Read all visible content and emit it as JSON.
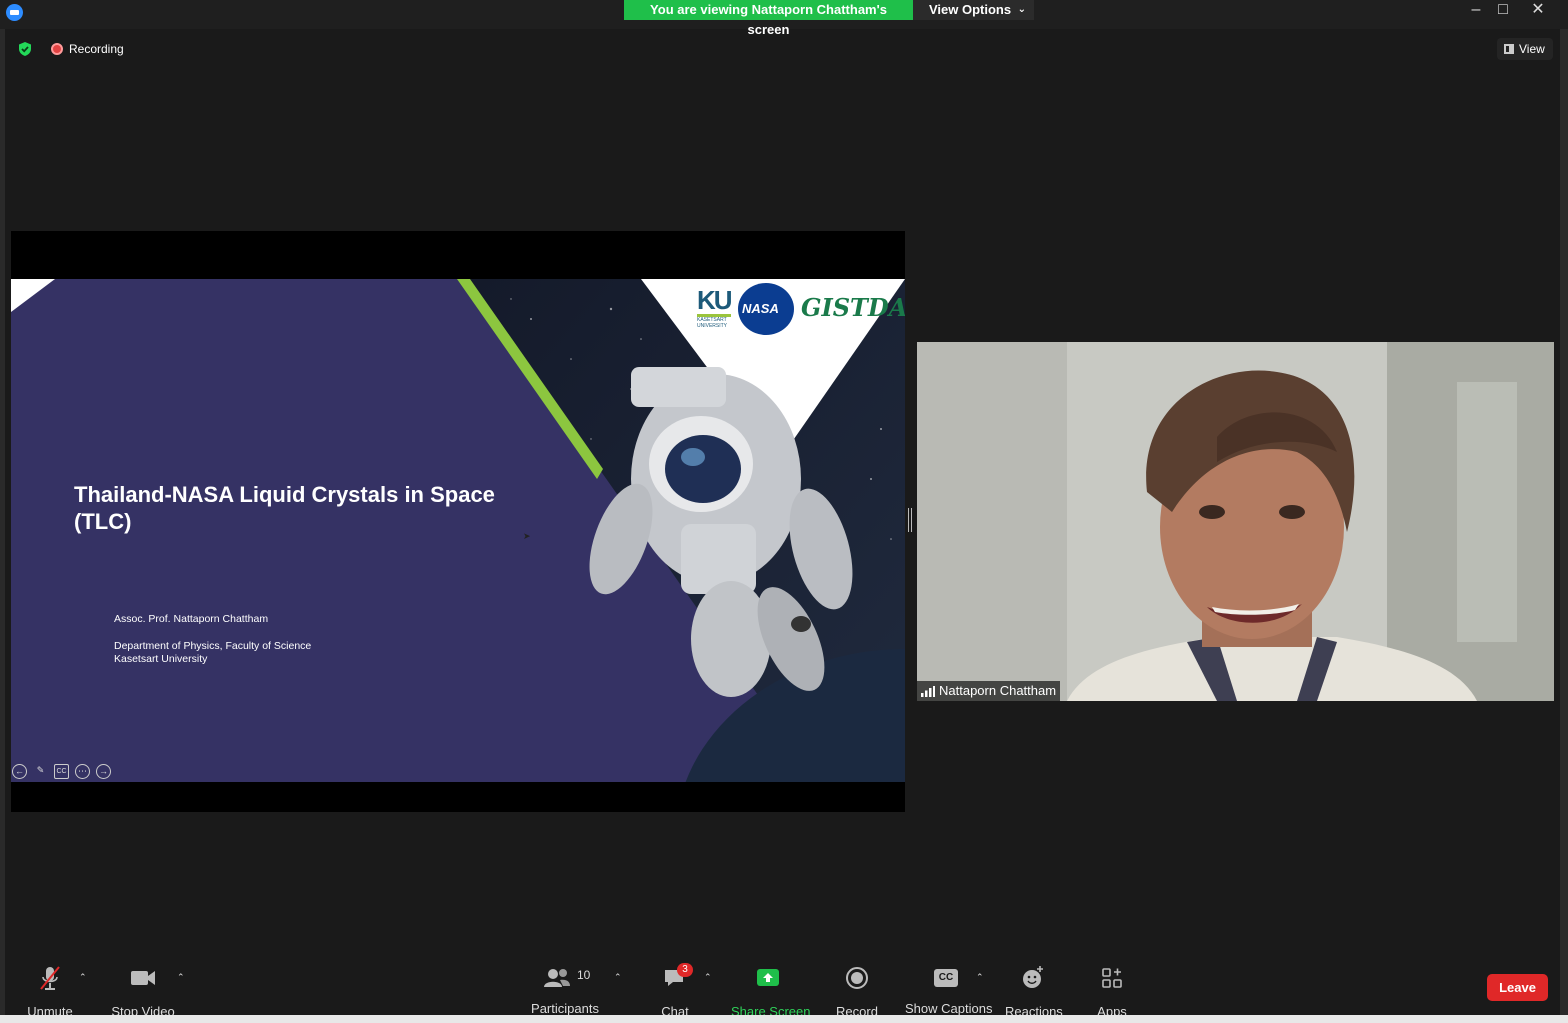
{
  "banner": {
    "viewing_text": "You are viewing Nattaporn Chattham's screen",
    "view_options_label": "View Options"
  },
  "status": {
    "recording_label": "Recording",
    "view_label": "View"
  },
  "slide": {
    "title": "Thailand-NASA Liquid Crystals in Space (TLC)",
    "author": "Assoc. Prof. Nattaporn Chattham",
    "department": "Department of Physics, Faculty of Science",
    "university": "Kasetsart University",
    "logos": {
      "ku": "KU",
      "ku_sub1": "KASETSART",
      "ku_sub2": "UNIVERSITY",
      "nasa": "NASA",
      "gistda": "GISTDA"
    },
    "controls": [
      "back-arrow-icon",
      "pen-icon",
      "cc-icon",
      "more-icon",
      "forward-arrow-icon"
    ],
    "cc_label": "CC"
  },
  "participant": {
    "name": "Nattaporn Chattham"
  },
  "toolbar": {
    "unmute_label": "Unmute",
    "stop_video_label": "Stop Video",
    "participants_label": "Participants",
    "participants_count": "10",
    "chat_label": "Chat",
    "chat_badge": "3",
    "share_screen_label": "Share Screen",
    "record_label": "Record",
    "show_captions_label": "Show Captions",
    "captions_icon_text": "CC",
    "reactions_label": "Reactions",
    "apps_label": "Apps",
    "leave_label": "Leave"
  },
  "colors": {
    "share_green": "#1fbf4a",
    "slide_purple": "#353264",
    "leave_red": "#e02828"
  }
}
